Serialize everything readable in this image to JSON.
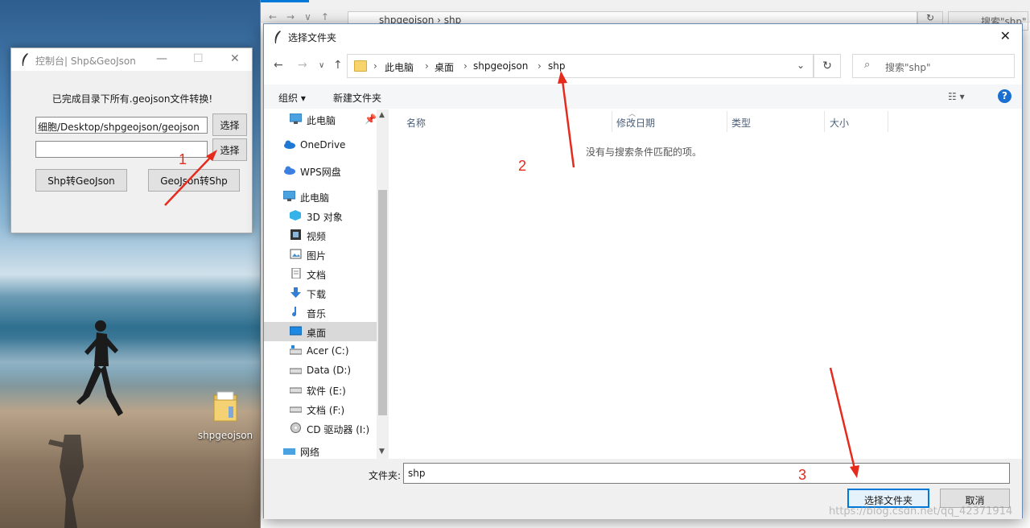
{
  "desktop": {
    "icon_label": "shpgeojson"
  },
  "back_window": {
    "address": "shpgeojson  ›  shp",
    "search": "搜索\"shp\""
  },
  "tk_window": {
    "title": "控制台| Shp&GeoJson",
    "message": "已完成目录下所有.geojson文件转换!",
    "entry1_value": "细胞/Desktop/shpgeojson/geojson",
    "entry2_value": "",
    "select_btn1": "选择",
    "select_btn2": "选择",
    "btn_shp_to_geojson": "Shp转GeoJson",
    "btn_geojson_to_shp": "GeoJson转Shp"
  },
  "dialog": {
    "title": "选择文件夹",
    "breadcrumb": [
      "此电脑",
      "桌面",
      "shpgeojson",
      "shp"
    ],
    "search_placeholder": "搜索\"shp\"",
    "toolbar": {
      "organize": "组织 ▾",
      "new_folder": "新建文件夹"
    },
    "nav_items": [
      {
        "label": "此电脑",
        "icon": "pc-icon",
        "pinned": true
      },
      {
        "label": "OneDrive",
        "icon": "cloud-icon"
      },
      {
        "label": "WPS网盘",
        "icon": "cloud-icon"
      },
      {
        "label": "此电脑",
        "icon": "pc-icon"
      },
      {
        "label": "3D 对象",
        "icon": "cube-icon"
      },
      {
        "label": "视频",
        "icon": "video-icon"
      },
      {
        "label": "图片",
        "icon": "picture-icon"
      },
      {
        "label": "文档",
        "icon": "document-icon"
      },
      {
        "label": "下载",
        "icon": "download-icon"
      },
      {
        "label": "音乐",
        "icon": "music-icon"
      },
      {
        "label": "桌面",
        "icon": "desktop-icon",
        "selected": true
      },
      {
        "label": "Acer (C:)",
        "icon": "drive-icon"
      },
      {
        "label": "Data (D:)",
        "icon": "drive-icon"
      },
      {
        "label": "软件 (E:)",
        "icon": "drive-icon"
      },
      {
        "label": "文档 (F:)",
        "icon": "drive-icon"
      },
      {
        "label": "CD 驱动器 (I:)",
        "icon": "cd-icon"
      },
      {
        "label": "网络",
        "icon": "network-icon"
      }
    ],
    "columns": [
      "名称",
      "修改日期",
      "类型",
      "大小"
    ],
    "empty_message": "没有与搜索条件匹配的项。",
    "folder_label": "文件夹:",
    "folder_value": "shp",
    "select_button": "选择文件夹",
    "cancel_button": "取消"
  },
  "annotations": {
    "n1": "1",
    "n2": "2",
    "n3": "3",
    "color": "#e62a1c"
  },
  "watermark": "https://blog.csdn.net/qq_42371914"
}
